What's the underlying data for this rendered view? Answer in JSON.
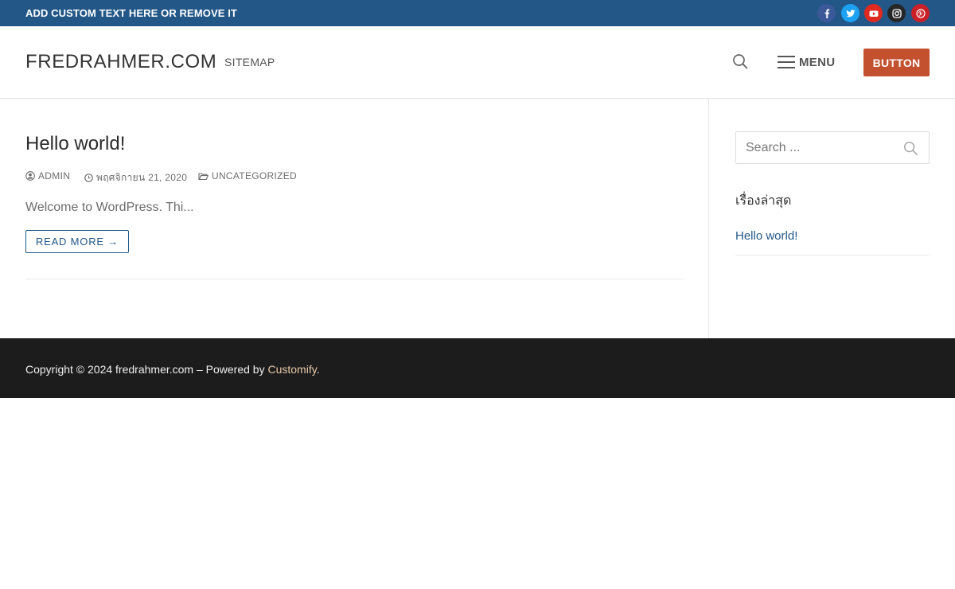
{
  "topbar": {
    "text": "ADD CUSTOM TEXT HERE OR REMOVE IT",
    "background": "#235787",
    "social": [
      {
        "icon": "facebook-icon",
        "color": "#3b5998"
      },
      {
        "icon": "twitter-icon",
        "color": "#1da1f2"
      },
      {
        "icon": "youtube-icon",
        "color": "#e02a20"
      },
      {
        "icon": "instagram-icon",
        "color": "#262626"
      },
      {
        "icon": "pinterest-icon",
        "color": "#cb2027"
      }
    ]
  },
  "header": {
    "site_title": "FREDRAHMER.COM",
    "nav": [
      {
        "label": "SITEMAP"
      }
    ],
    "menu_label": "MENU",
    "button_label": "BUTTON",
    "button_color": "#c3512f"
  },
  "post": {
    "title": "Hello world!",
    "author": "ADMIN",
    "date": "พฤศจิกายน 21, 2020",
    "category": "UNCATEGORIZED",
    "excerpt": "Welcome to WordPress. Thi...",
    "read_more": "READ MORE →"
  },
  "sidebar": {
    "search_placeholder": "Search ...",
    "recent_title": "เรื่องล่าสุด",
    "recent_posts": [
      {
        "label": "Hello world!"
      }
    ]
  },
  "footer": {
    "text": "Copyright © 2024 fredrahmer.com – Powered by ",
    "link": "Customify",
    "suffix": ".",
    "background": "#1c1c1c"
  },
  "colors": {
    "accent": "#235787",
    "button": "#c3512f"
  }
}
